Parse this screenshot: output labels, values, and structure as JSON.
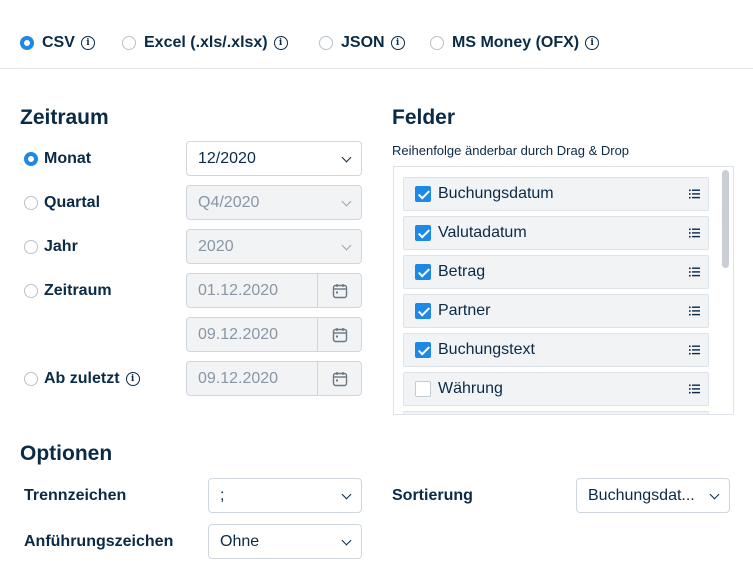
{
  "formats": [
    {
      "label": "CSV",
      "selected": true
    },
    {
      "label": "Excel (.xls/.xlsx)",
      "selected": false
    },
    {
      "label": "JSON",
      "selected": false
    },
    {
      "label": "MS Money (OFX)",
      "selected": false
    }
  ],
  "zeitraum": {
    "title": "Zeitraum",
    "options": [
      {
        "label": "Monat",
        "selected": true,
        "value": "12/2020"
      },
      {
        "label": "Quartal",
        "selected": false,
        "value": "Q4/2020"
      },
      {
        "label": "Jahr",
        "selected": false,
        "value": "2020"
      },
      {
        "label": "Zeitraum",
        "selected": false,
        "from": "01.12.2020",
        "to": "09.12.2020"
      },
      {
        "label": "Ab zuletzt",
        "selected": false,
        "value": "09.12.2020"
      }
    ]
  },
  "felder": {
    "title": "Felder",
    "subtitle": "Reihenfolge änderbar durch Drag & Drop",
    "items": [
      {
        "label": "Buchungsdatum",
        "checked": true
      },
      {
        "label": "Valutadatum",
        "checked": true
      },
      {
        "label": "Betrag",
        "checked": true
      },
      {
        "label": "Partner",
        "checked": true
      },
      {
        "label": "Buchungstext",
        "checked": true
      },
      {
        "label": "Währung",
        "checked": false
      }
    ]
  },
  "optionen": {
    "title": "Optionen",
    "trennzeichen": {
      "label": "Trennzeichen",
      "value": ";"
    },
    "anfuehrungszeichen": {
      "label": "Anführungszeichen",
      "value": "Ohne"
    },
    "sortierung": {
      "label": "Sortierung",
      "value": "Buchungsdat..."
    }
  },
  "info_glyph": "i",
  "colors": {
    "accent": "#1e88e5",
    "text": "#0b2a45",
    "disabled_bg": "#f1f3f5"
  }
}
